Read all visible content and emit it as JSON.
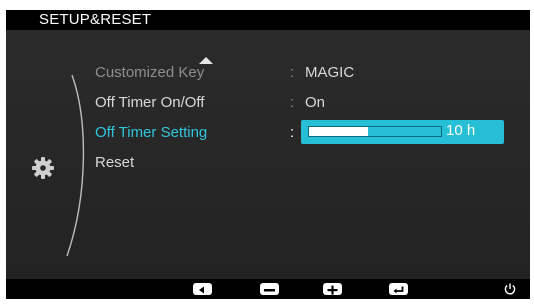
{
  "header": {
    "title": "SETUP&RESET"
  },
  "menu": {
    "items": [
      {
        "label": "Customized Key",
        "value": "MAGIC",
        "state": "dim"
      },
      {
        "label": "Off Timer On/Off",
        "value": "On",
        "state": "normal"
      },
      {
        "label": "Off Timer Setting",
        "value": "10 h",
        "state": "active"
      },
      {
        "label": "Reset",
        "value": "",
        "state": "normal"
      }
    ],
    "colon": ":",
    "timer_setting_fraction": 0.45
  },
  "icons": {
    "category": "gear-icon",
    "scroll_up": "triangle-up-icon",
    "buttons": [
      "left-arrow-icon",
      "minus-icon",
      "plus-icon",
      "enter-icon",
      "power-icon"
    ]
  },
  "colors": {
    "accent": "#27bfd5",
    "active_text": "#2fc6de",
    "background": "#262626"
  }
}
